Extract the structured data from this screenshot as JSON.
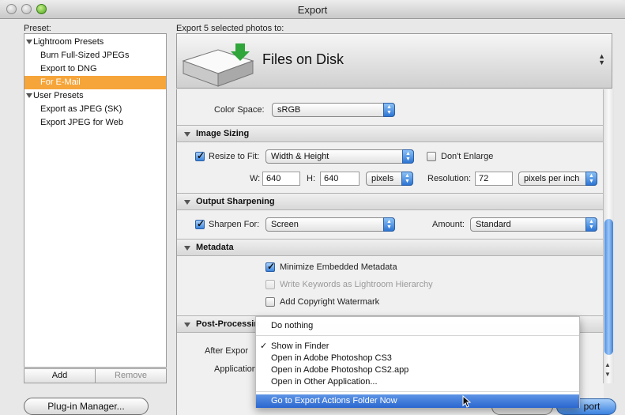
{
  "window": {
    "title": "Export"
  },
  "preset": {
    "label": "Preset:",
    "items": [
      {
        "label": "Lightroom Presets",
        "type": "group"
      },
      {
        "label": "Burn Full-Sized JPEGs",
        "type": "child"
      },
      {
        "label": "Export to DNG",
        "type": "child"
      },
      {
        "label": "For E-Mail",
        "type": "child",
        "selected": true
      },
      {
        "label": "User Presets",
        "type": "group"
      },
      {
        "label": "Export as JPEG (SK)",
        "type": "child"
      },
      {
        "label": "Export JPEG for Web",
        "type": "child"
      }
    ],
    "add_label": "Add",
    "remove_label": "Remove"
  },
  "export_to": {
    "label": "Export 5 selected photos to:",
    "destination": "Files on Disk"
  },
  "color_space": {
    "label": "Color Space:",
    "value": "sRGB"
  },
  "image_sizing": {
    "title": "Image Sizing",
    "resize_label": "Resize to Fit:",
    "resize_checked": true,
    "resize_mode": "Width & Height",
    "dont_enlarge_label": "Don't Enlarge",
    "dont_enlarge_checked": false,
    "w_label": "W:",
    "w_value": "640",
    "h_label": "H:",
    "h_value": "640",
    "unit": "pixels",
    "resolution_label": "Resolution:",
    "resolution_value": "72",
    "resolution_unit": "pixels per inch"
  },
  "output_sharpening": {
    "title": "Output Sharpening",
    "sharpen_label": "Sharpen For:",
    "sharpen_checked": true,
    "sharpen_value": "Screen",
    "amount_label": "Amount:",
    "amount_value": "Standard"
  },
  "metadata": {
    "title": "Metadata",
    "minimize_label": "Minimize Embedded Metadata",
    "minimize_checked": true,
    "keywords_label": "Write Keywords as Lightroom Hierarchy",
    "keywords_checked": false,
    "watermark_label": "Add Copyright Watermark",
    "watermark_checked": false
  },
  "post_processing": {
    "title": "Post-Processin",
    "after_export_label": "After Expor",
    "application_label": "Application"
  },
  "menu": {
    "items": [
      {
        "label": "Do nothing",
        "checked": false
      },
      {
        "label": "Show in Finder",
        "checked": true
      },
      {
        "label": "Open in Adobe Photoshop CS3",
        "checked": false
      },
      {
        "label": "Open in Adobe Photoshop CS2.app",
        "checked": false
      },
      {
        "label": "Open in Other Application...",
        "checked": false
      },
      {
        "label": "Go to Export Actions Folder Now",
        "checked": false,
        "highlighted": true
      }
    ]
  },
  "footer": {
    "plugin_manager_label": "Plug-in Manager...",
    "export_label": "port"
  },
  "colors": {
    "selection": "#f6a53a",
    "accent": "#3b82e0"
  }
}
